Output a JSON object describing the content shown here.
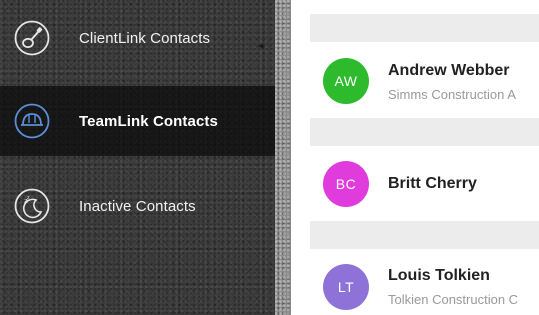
{
  "sidebar": {
    "items": [
      {
        "label": "ClientLink Contacts",
        "icon": "guitar-icon",
        "active": false
      },
      {
        "label": "TeamLink Contacts",
        "icon": "hard-hat-icon",
        "active": true
      },
      {
        "label": "Inactive Contacts",
        "icon": "sleeping-moon-icon",
        "active": false
      }
    ],
    "active_icon_color": "#5b8fd8",
    "icon_color": "#e6e6e6"
  },
  "contacts": [
    {
      "initials": "AW",
      "name": "Andrew Webber",
      "company": "Simms Construction A",
      "avatar_color": "#2dbb2d"
    },
    {
      "initials": "BC",
      "name": "Britt Cherry",
      "company": "",
      "avatar_color": "#e03bdc"
    },
    {
      "initials": "LT",
      "name": "Louis Tolkien",
      "company": "Tolkien Construction C",
      "avatar_color": "#8f72d8"
    }
  ]
}
